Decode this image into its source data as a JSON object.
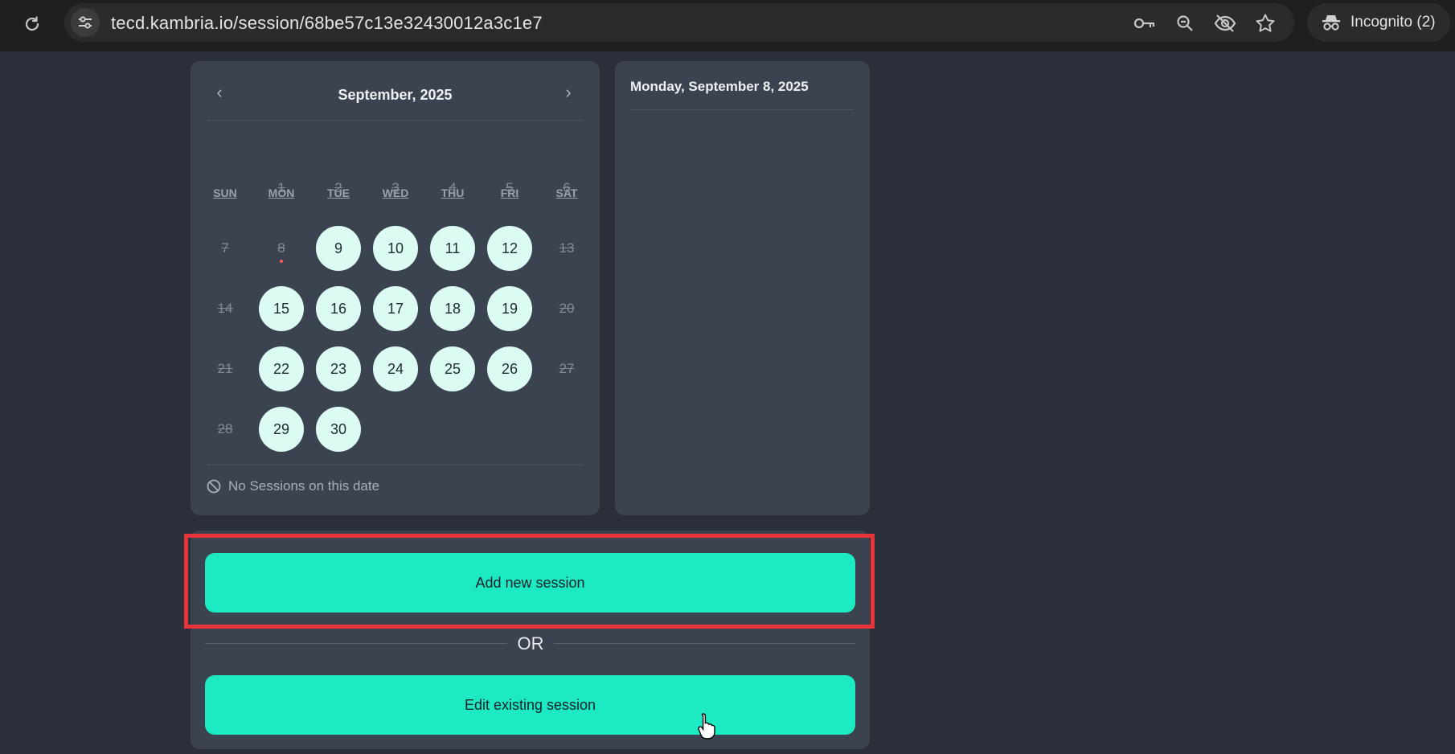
{
  "browser": {
    "url": "tecd.kambria.io/session/68be57c13e32430012a3c1e7",
    "incognito_label": "Incognito (2)"
  },
  "calendar": {
    "month_title": "September, 2025",
    "prev_label": "‹",
    "next_label": "›",
    "weekdays": [
      "SUN",
      "MON",
      "TUE",
      "WED",
      "THU",
      "FRI",
      "SAT"
    ],
    "weeks": [
      [
        null,
        {
          "d": "1",
          "s": "off"
        },
        {
          "d": "2",
          "s": "off"
        },
        {
          "d": "3",
          "s": "off"
        },
        {
          "d": "4",
          "s": "off"
        },
        {
          "d": "5",
          "s": "off"
        },
        {
          "d": "6",
          "s": "off"
        }
      ],
      [
        {
          "d": "7",
          "s": "off"
        },
        {
          "d": "8",
          "s": "today"
        },
        {
          "d": "9",
          "s": "avail"
        },
        {
          "d": "10",
          "s": "avail"
        },
        {
          "d": "11",
          "s": "avail"
        },
        {
          "d": "12",
          "s": "avail"
        },
        {
          "d": "13",
          "s": "off"
        }
      ],
      [
        {
          "d": "14",
          "s": "off"
        },
        {
          "d": "15",
          "s": "avail"
        },
        {
          "d": "16",
          "s": "avail"
        },
        {
          "d": "17",
          "s": "avail"
        },
        {
          "d": "18",
          "s": "avail"
        },
        {
          "d": "19",
          "s": "avail"
        },
        {
          "d": "20",
          "s": "off"
        }
      ],
      [
        {
          "d": "21",
          "s": "off"
        },
        {
          "d": "22",
          "s": "avail"
        },
        {
          "d": "23",
          "s": "avail"
        },
        {
          "d": "24",
          "s": "avail"
        },
        {
          "d": "25",
          "s": "avail"
        },
        {
          "d": "26",
          "s": "avail"
        },
        {
          "d": "27",
          "s": "off"
        }
      ],
      [
        {
          "d": "28",
          "s": "off"
        },
        {
          "d": "29",
          "s": "avail"
        },
        {
          "d": "30",
          "s": "avail"
        },
        null,
        null,
        null,
        null
      ]
    ],
    "no_sessions_text": "No Sessions on this date"
  },
  "detail": {
    "date_title": "Monday, September 8, 2025"
  },
  "actions": {
    "add_label": "Add new session",
    "or_label": "OR",
    "edit_label": "Edit existing session"
  },
  "colors": {
    "accent": "#1de9c2",
    "available_day": "#dcfcf3",
    "highlight": "#e8333b",
    "background": "#2a2f3a",
    "card": "#3b4250"
  }
}
